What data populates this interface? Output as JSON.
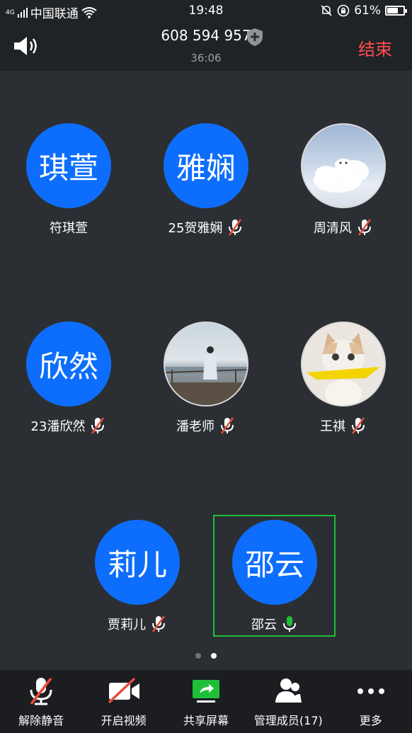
{
  "status_bar": {
    "carrier": "中国联通",
    "network": "4G",
    "time": "19:48",
    "battery": "61%"
  },
  "header": {
    "meeting_id": "608 594 957",
    "duration": "36:06",
    "end_label": "结束"
  },
  "participants": [
    {
      "avatar_text": "琪萱",
      "name": "符琪萱",
      "muted": false
    },
    {
      "avatar_text": "雅娴",
      "name": "25贺雅娴",
      "muted": true
    },
    {
      "avatar_text": "",
      "name": "周清风",
      "muted": true
    },
    {
      "avatar_text": "欣然",
      "name": "23潘欣然",
      "muted": true
    },
    {
      "avatar_text": "",
      "name": "潘老师",
      "muted": true
    },
    {
      "avatar_text": "",
      "name": "王祺",
      "muted": true
    },
    {
      "avatar_text": "莉儿",
      "name": "贾莉儿",
      "muted": true
    },
    {
      "avatar_text": "邵云",
      "name": "邵云",
      "muted": false,
      "speaking": true
    }
  ],
  "pagination": {
    "pages": 2,
    "current": 2
  },
  "toolbar": {
    "unmute_label": "解除静音",
    "video_label": "开启视频",
    "share_label": "共享屏幕",
    "members_label": "管理成员(17)",
    "more_label": "更多"
  },
  "colors": {
    "accent_blue": "#0d6efd",
    "end_red": "#ff4d4f",
    "mute_red": "#e74c3c",
    "speaking_green": "#1fbf3a"
  }
}
